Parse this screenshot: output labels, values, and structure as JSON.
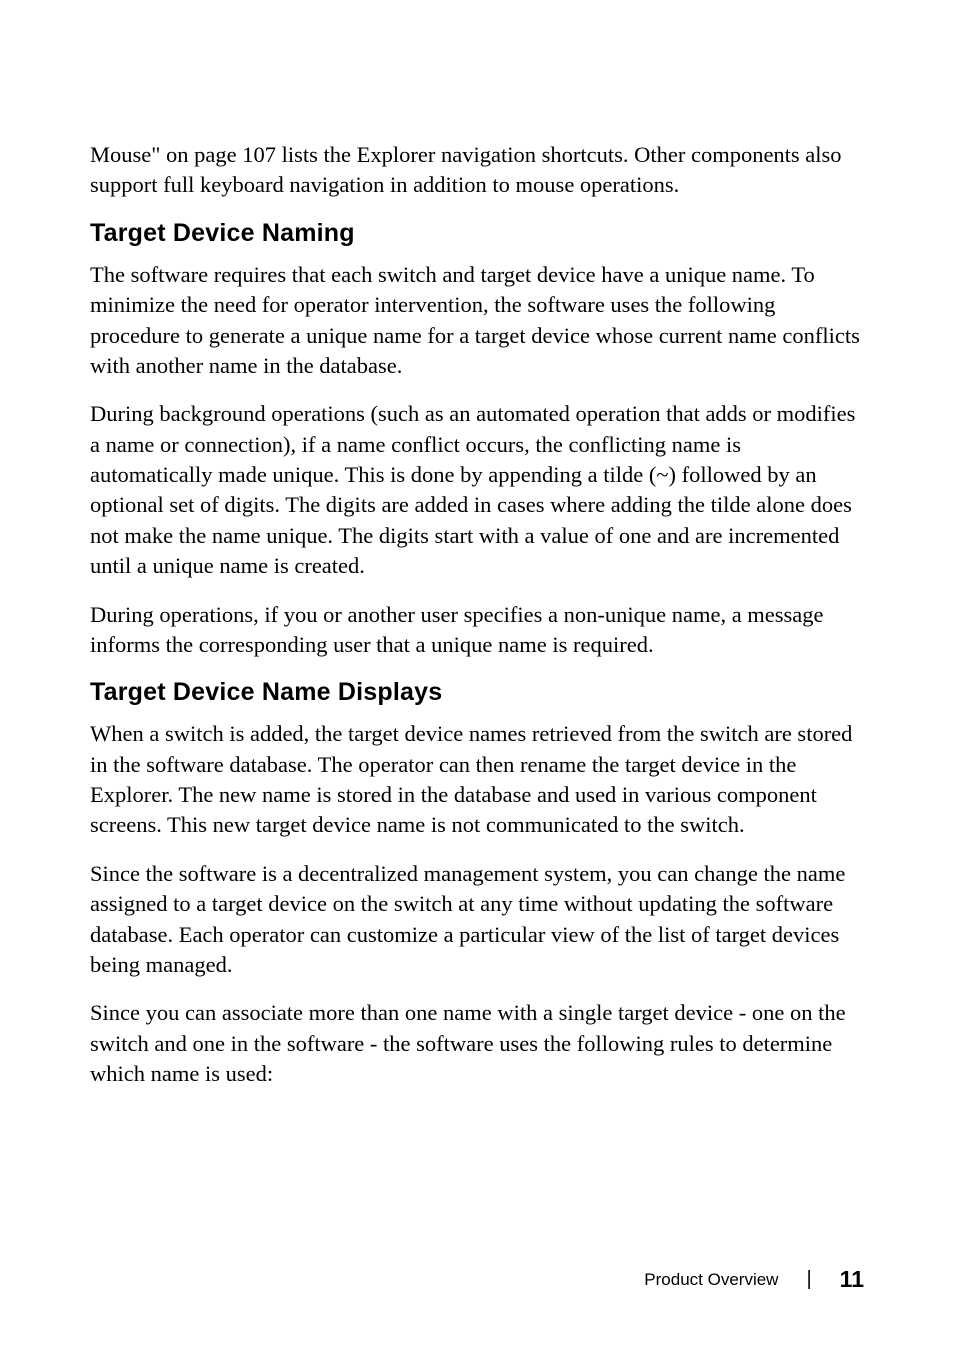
{
  "intro": {
    "p1": "Mouse\" on page 107 lists the Explorer navigation shortcuts. Other components also support full keyboard navigation in addition to mouse operations."
  },
  "section1": {
    "heading": "Target Device Naming",
    "p1": "The software requires that each switch and target device have a unique name. To minimize the need for operator intervention, the software uses the following procedure to generate a unique name for a target device whose current name conflicts with another name in the database.",
    "p2": "During background operations (such as an automated operation that adds or modifies a name or connection), if a name conflict occurs, the conflicting name is automatically made unique. This is done by appending a tilde (~) followed by an optional set of digits. The digits are added in cases where adding the tilde alone does not make the name unique. The digits start with a value of one and are incremented until a unique name is created.",
    "p3": "During operations, if you or another user specifies a non-unique name, a message informs the corresponding user that a unique name is required."
  },
  "section2": {
    "heading": "Target Device Name Displays",
    "p1": "When a switch is added, the target device names retrieved from the switch are stored in the software database. The operator can then rename the target device in the Explorer. The new name is stored in the database and used in various component screens. This new target device name is not communicated to the switch.",
    "p2": "Since the software is a decentralized management system, you can change the name assigned to a target device on the switch at any time without updating the software database. Each operator can customize a particular view of the list of target devices being managed.",
    "p3": "Since you can associate more than one name with a single target device - one on the switch and one in the software - the software uses the following rules to determine which name is used:"
  },
  "footer": {
    "section": "Product Overview",
    "divider": "|",
    "page": "11"
  }
}
